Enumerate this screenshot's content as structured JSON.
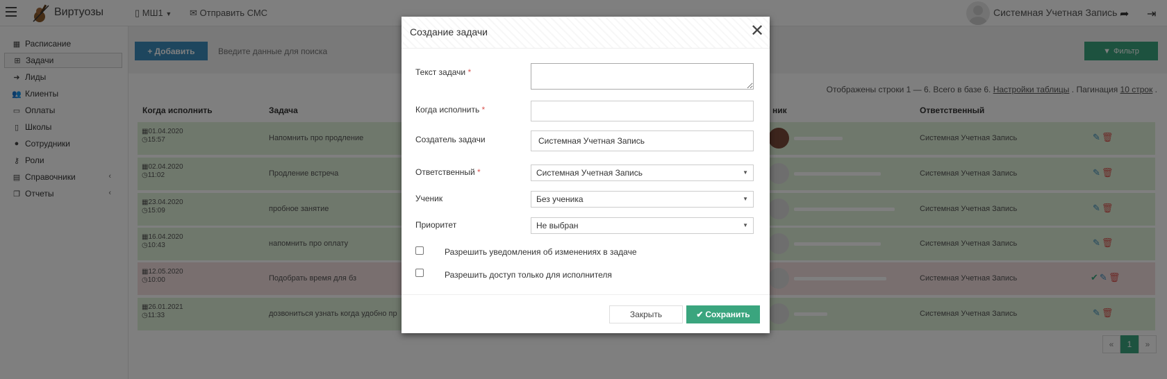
{
  "topbar": {
    "brand": "Виртуозы",
    "school": "МШ1",
    "sms_link": "Отправить СМС",
    "user_name": "Системная Учетная Запись"
  },
  "sidebar": {
    "items": [
      {
        "label": "Расписание",
        "icon": "calendar-icon"
      },
      {
        "label": "Задачи",
        "icon": "calendar-plus-icon",
        "active": true
      },
      {
        "label": "Лиды",
        "icon": "sign-in-icon"
      },
      {
        "label": "Клиенты",
        "icon": "users-icon"
      },
      {
        "label": "Оплаты",
        "icon": "credit-card-icon"
      },
      {
        "label": "Школы",
        "icon": "building-icon"
      },
      {
        "label": "Сотрудники",
        "icon": "user-icon"
      },
      {
        "label": "Роли",
        "icon": "key-icon"
      },
      {
        "label": "Справочники",
        "icon": "book-icon",
        "has_children": true
      },
      {
        "label": "Отчеты",
        "icon": "copy-icon",
        "has_children": true
      }
    ]
  },
  "toolbar": {
    "add_label": "Добавить",
    "search_placeholder": "Введите данные для поиска",
    "filter_label": "Фильтр"
  },
  "table": {
    "info_prefix": "Отображены строки 1 — 6. Всего в базе 6.",
    "settings_link": "Настройки таблицы",
    "pagination_label": ". Пагинация",
    "pagination_value": "10 строк",
    "columns": [
      "Когда исполнить",
      "Задача",
      "ник",
      "Ответственный"
    ],
    "rows": [
      {
        "date": "01.04.2020",
        "time": "15:57",
        "task": "Напомнить про продление",
        "responsible": "Системная Учетная Запись",
        "status": "green"
      },
      {
        "date": "02.04.2020",
        "time": "11:02",
        "task": "Продление встреча",
        "responsible": "Системная Учетная Запись",
        "status": "green"
      },
      {
        "date": "23.04.2020",
        "time": "15:09",
        "task": "пробное занятие",
        "responsible": "Системная Учетная Запись",
        "status": "green"
      },
      {
        "date": "16.04.2020",
        "time": "10:43",
        "task": "напомнить про оплату",
        "responsible": "Системная Учетная Запись",
        "status": "green"
      },
      {
        "date": "12.05.2020",
        "time": "10:00",
        "task": "Подобрать время для бз",
        "responsible": "Системная Учетная Запись",
        "status": "red"
      },
      {
        "date": "26.01.2021",
        "time": "11:33",
        "task": "дозвониться узнать когда удобно пр",
        "responsible": "Системная Учетная Запись",
        "status": "green"
      }
    ],
    "pages": [
      "«",
      "1",
      "»"
    ]
  },
  "modal": {
    "title": "Создание задачи",
    "fields": {
      "task_text_label": "Текст задачи",
      "when_label": "Когда исполнить",
      "creator_label": "Создатель задачи",
      "creator_value": "Системная Учетная Запись",
      "responsible_label": "Ответственный",
      "responsible_value": "Системная Учетная Запись",
      "student_label": "Ученик",
      "student_value": "Без ученика",
      "priority_label": "Приоритет",
      "priority_value": "Не выбран"
    },
    "required_mark": "*",
    "checkbox_notify": "Разрешить уведомления об изменениях в задаче",
    "checkbox_access": "Разрешить доступ только для исполнителя",
    "close_label": "Закрыть",
    "save_label": "Сохранить"
  }
}
